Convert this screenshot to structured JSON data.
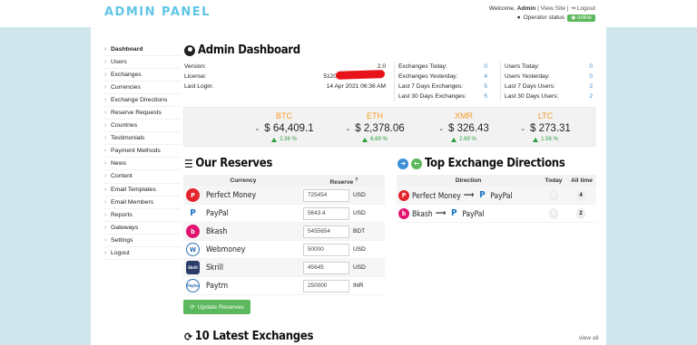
{
  "header": {
    "logo": "ADMIN PANEL",
    "welcome_prefix": "Welcome, ",
    "username": "Admin",
    "view_site": "View Site",
    "logout_link": "Logout",
    "operator_status_label": "Operator status",
    "operator_status_value": "online"
  },
  "sidebar": {
    "items": [
      {
        "label": "Dashboard"
      },
      {
        "label": "Users"
      },
      {
        "label": "Exchanges"
      },
      {
        "label": "Currencies"
      },
      {
        "label": "Exchange Directions"
      },
      {
        "label": "Reserve Requests"
      },
      {
        "label": "Countries"
      },
      {
        "label": "Testimonials"
      },
      {
        "label": "Payment Methods"
      },
      {
        "label": "News"
      },
      {
        "label": "Content"
      },
      {
        "label": "Email Templates"
      },
      {
        "label": "Email Members"
      },
      {
        "label": "Reports"
      },
      {
        "label": "Gateways"
      },
      {
        "label": "Settings"
      },
      {
        "label": "Logout"
      }
    ]
  },
  "dashboard": {
    "title": "Admin Dashboard",
    "version_label": "Version:",
    "version_value": "2.0",
    "license_label": "License:",
    "license_value": "5120",
    "last_login_label": "Last Login:",
    "last_login_value": "14 Apr 2021 06:36 AM",
    "exchange_stats": [
      {
        "label": "Exchanges Today:",
        "value": "0"
      },
      {
        "label": "Exchanges Yesterday:",
        "value": "4"
      },
      {
        "label": "Last 7 Days Exchanges:",
        "value": "5"
      },
      {
        "label": "Last 30 Days Exchanges:",
        "value": "5"
      }
    ],
    "user_stats": [
      {
        "label": "Users Today:",
        "value": "0"
      },
      {
        "label": "Users Yesterday:",
        "value": "0"
      },
      {
        "label": "Last 7 Days Users:",
        "value": "2"
      },
      {
        "label": "Last 30 Days Users:",
        "value": "2"
      }
    ]
  },
  "crypto": [
    {
      "symbol": "BTC",
      "price": "$ 64,409.1",
      "change": "2.36 %"
    },
    {
      "symbol": "ETH",
      "price": "$ 2,378.06",
      "change": "6.69 %"
    },
    {
      "symbol": "XMR",
      "price": "$ 326.43",
      "change": "2.69 %"
    },
    {
      "symbol": "LTC",
      "price": "$ 273.31",
      "change": "1.56 %"
    }
  ],
  "reserves": {
    "title": "Our Reserves",
    "col_currency": "Currency",
    "col_reserve": "Reserve",
    "reserve_hint": "?",
    "rows": [
      {
        "name": "Perfect Money",
        "icon": "P",
        "value": "725454",
        "currency": "USD"
      },
      {
        "name": "PayPal",
        "icon": "P",
        "value": "5643.4",
        "currency": "USD"
      },
      {
        "name": "Bkash",
        "icon": "b",
        "value": "5455654",
        "currency": "BDT"
      },
      {
        "name": "Webmoney",
        "icon": "W",
        "value": "50000",
        "currency": "USD"
      },
      {
        "name": "Skrill",
        "icon": "Skrill",
        "value": "45645",
        "currency": "USD"
      },
      {
        "name": "Paytm",
        "icon": "Paytm",
        "value": "250000",
        "currency": "INR"
      }
    ],
    "update_button": "Update Reserves"
  },
  "top_directions": {
    "title": "Top Exchange Directions",
    "col_direction": "Direction",
    "col_today": "Today",
    "col_all": "All time",
    "rows": [
      {
        "from": "Perfect Money",
        "to": "PayPal",
        "today": "0",
        "all": "4"
      },
      {
        "from": "Bkash",
        "to": "PayPal",
        "today": "0",
        "all": "2"
      }
    ]
  },
  "latest": {
    "title": "10 Latest Exchanges",
    "view_all": "view all"
  },
  "colors": {
    "accent": "#5fc6e6",
    "crypto_symbol": "#f39c24",
    "positive": "#2a9d3a",
    "online": "#5cb85c",
    "band": "#cfe7ec"
  }
}
